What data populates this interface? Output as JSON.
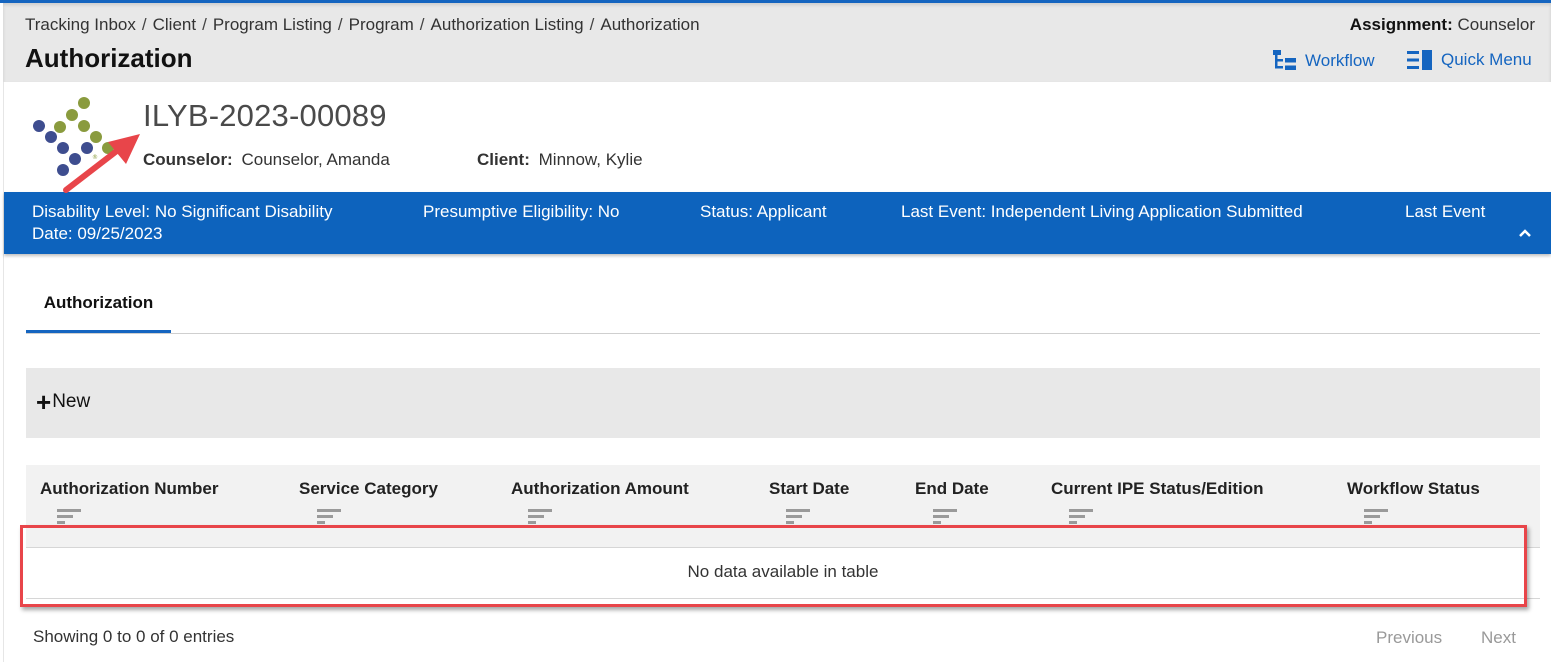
{
  "header": {
    "breadcrumb": [
      "Tracking Inbox",
      "Client",
      "Program Listing",
      "Program",
      "Authorization Listing",
      "Authorization"
    ],
    "breadcrumb_separator": "/",
    "title": "Authorization",
    "assignment_label": "Assignment:",
    "assignment_value": "Counselor",
    "workflow_label": "Workflow",
    "workflow_icon": "workflow-tree-icon",
    "quick_menu_label": "Quick Menu",
    "quick_menu_icon": "quick-menu-icon"
  },
  "record": {
    "id": "ILYB-2023-00089",
    "counselor_label": "Counselor:",
    "counselor_value": "Counselor, Amanda",
    "client_label": "Client:",
    "client_value": "Minnow, Kylie"
  },
  "banner": {
    "disability_level": "Disability Level: No Significant Disability",
    "presumptive_eligibility": "Presumptive Eligibility: No",
    "status": "Status: Applicant",
    "last_event": "Last Event: Independent Living Application Submitted",
    "last_event_date_label": "Last Event",
    "last_event_date_value": "Date: 09/25/2023",
    "collapse_icon": "chevron-up-icon"
  },
  "tabs": [
    {
      "label": "Authorization",
      "active": true
    }
  ],
  "toolbar": {
    "new_icon": "plus-icon",
    "new_label": "New"
  },
  "table": {
    "columns": [
      "Authorization Number",
      "Service Category",
      "Authorization Amount",
      "Start Date",
      "End Date",
      "Current IPE Status/Edition",
      "Workflow Status"
    ],
    "rows": [],
    "empty_message": "No data available in table"
  },
  "footer": {
    "showing": "Showing 0 to 0 of 0 entries",
    "previous_label": "Previous",
    "next_label": "Next"
  },
  "colors": {
    "accent": "#1565c0",
    "banner": "#0d63bd",
    "header_bg": "#e8e8e8",
    "annotation": "#e8454a"
  }
}
